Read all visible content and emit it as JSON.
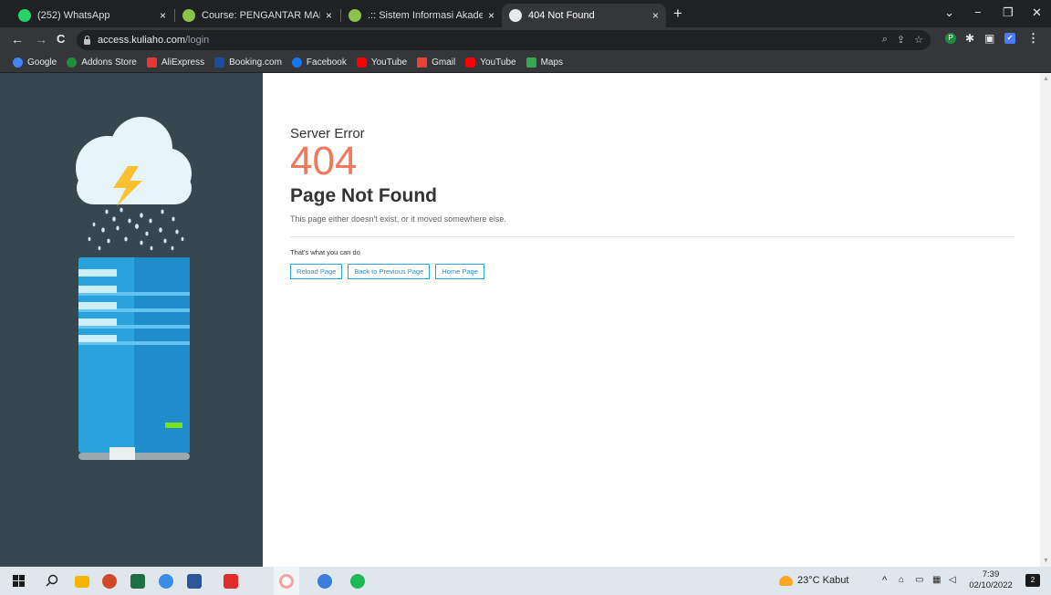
{
  "browser": {
    "tabs": [
      {
        "title": "(252) WhatsApp",
        "close": "×",
        "favicon_color": "#25d366",
        "active": false
      },
      {
        "title": "Course: PENGANTAR MANAJEMEN",
        "close": "×",
        "favicon_color": "#8bc34a",
        "active": false
      },
      {
        "title": ".:: Sistem Informasi Akademik Uni",
        "close": "×",
        "favicon_color": "#8bc34a",
        "active": false
      },
      {
        "title": "404 Not Found",
        "close": "×",
        "favicon_color": "#9aa0a6",
        "active": true
      }
    ],
    "new_tab_label": "+",
    "window_controls": {
      "search": "⌄",
      "minimize": "−",
      "maximize": "❐",
      "close": "✕"
    },
    "nav": {
      "back": "←",
      "forward": "→",
      "reload": "C"
    },
    "url": {
      "host": "access.kuliaho.com",
      "path": "/login"
    },
    "omnibox_icons": {
      "zoom": "⌕",
      "share": "⇪",
      "bookmark": "☆"
    },
    "toolbar_extensions": {
      "profile": "P",
      "extensions": "✱",
      "sidepanel": "▣",
      "shield": "✔",
      "menu": "⋮"
    },
    "bookmarks": [
      {
        "label": "Google",
        "color": "#4285f4"
      },
      {
        "label": "Addons Store",
        "color": "#1e8e3e"
      },
      {
        "label": "AliExpress",
        "color": "#e53935"
      },
      {
        "label": "Booking.com",
        "color": "#1a4fa0"
      },
      {
        "label": "Facebook",
        "color": "#1877f2"
      },
      {
        "label": "YouTube",
        "color": "#ff0000"
      },
      {
        "label": "Gmail",
        "color": "#ea4335"
      },
      {
        "label": "YouTube",
        "color": "#ff0000"
      },
      {
        "label": "Maps",
        "color": "#34a853"
      }
    ]
  },
  "page": {
    "heading": "Server Error",
    "code": "404",
    "title": "Page Not Found",
    "description": "This page either doesn't exist, or it moved somewhere else.",
    "actions_label": "That's what you can do",
    "buttons": {
      "reload": "Reload Page",
      "back": "Back to Previous Page",
      "home": "Home Page"
    },
    "colors": {
      "accent": "#f0795b",
      "button": "#2aa8d9",
      "panel": "#37474f"
    }
  },
  "taskbar": {
    "weather": "23°C  Kabut",
    "tray_chevron": "^",
    "time": "7:39",
    "date": "02/10/2022",
    "notifications": "2"
  }
}
